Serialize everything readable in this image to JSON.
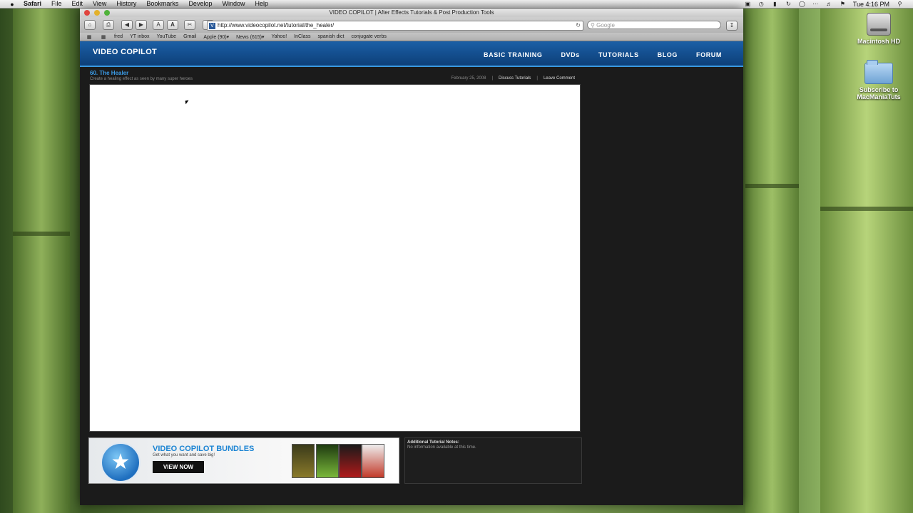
{
  "menubar": {
    "apple": "",
    "items": [
      "Safari",
      "File",
      "Edit",
      "View",
      "History",
      "Bookmarks",
      "Develop",
      "Window",
      "Help"
    ],
    "clock": "Tue 4:16 PM"
  },
  "desktop": {
    "icons": [
      {
        "label": "Macintosh HD",
        "icon": "hard-drive-icon"
      },
      {
        "label": "Subscribe to MacManiaTuts",
        "icon": "folder-icon"
      }
    ]
  },
  "browser": {
    "window_title": "VIDEO COPILOT | After Effects Tutorials & Post Production Tools",
    "url": "http://www.videocopilot.net/tutorial/the_healer/",
    "search_placeholder": "Google",
    "bookmarks": [
      "fred",
      "YT inbox",
      "YouTube",
      "Gmail",
      "Apple (90)▾",
      "News (615)▾",
      "Yahoo!",
      "InClass",
      "spanish dict",
      "conjugate verbs"
    ]
  },
  "site": {
    "logo": "VIDEO COPILOT",
    "nav": [
      "BASIC TRAINING",
      "DVDs",
      "TUTORIALS",
      "BLOG",
      "FORUM"
    ],
    "tutorial": {
      "title": "60. The Healer",
      "subtitle": "Create a healing effect as seen by many super heroes",
      "date": "February 25, 2008",
      "sep": "|",
      "discuss": "Discuss Tutorials",
      "comment": "Leave Comment"
    },
    "banner": {
      "title": "VIDEO COPILOT BUNDLES",
      "subtitle": "Get what you want and save big!",
      "button": "VIEW NOW"
    },
    "notes": {
      "title": "Additional Tutorial Notes:",
      "text": "No information available at this time."
    }
  }
}
